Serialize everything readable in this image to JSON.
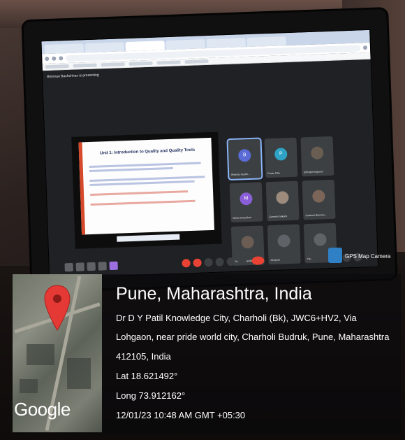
{
  "stamp": {
    "place": "Pune, Maharashtra, India",
    "address_lines": [
      "Dr D Y Patil Knowledge City, Charholi (Bk), JWC6+HV2, Via",
      "Lohgaon, near pride world city, Charholi Budruk, Pune, Maharashtra",
      "412105, India"
    ],
    "lat": "Lat 18.621492°",
    "long": "Long 73.912162°",
    "datetime": "12/01/23 10:48 AM GMT +05:30",
    "map_attribution": "Google",
    "app_label": "GPS Map Camera",
    "pin_icon": "map-pin-icon"
  },
  "screen": {
    "presenting_banner": "Bhimrao Bachchhav is presenting",
    "slide_title": "Unit 1: Introduction to Quality and Quality Tools",
    "tiles": [
      {
        "name": "Bhimrao Bachh...",
        "initial": "B",
        "color": "#5b6bd6"
      },
      {
        "name": "Pravin Pitle",
        "initial": "P",
        "color": "#2ea3c6"
      },
      {
        "name": "prthvijeet kapurse",
        "initial": "",
        "color": "#6a5d52"
      },
      {
        "name": "Mehul Chaudhari",
        "initial": "M",
        "color": "#8a5ed6"
      },
      {
        "name": "Ganesh Kulkarni",
        "initial": "",
        "color": "#9c8b7d"
      },
      {
        "name": "Sonkumi Bansmo...",
        "initial": "",
        "color": "#7a6558"
      },
      {
        "name": "Swapnil anandha",
        "initial": "",
        "color": "#6b5c54"
      },
      {
        "name": "ACQuiet",
        "initial": "",
        "color": "#5f6368"
      },
      {
        "name": "You",
        "initial": "",
        "color": "#5f6368"
      }
    ]
  }
}
